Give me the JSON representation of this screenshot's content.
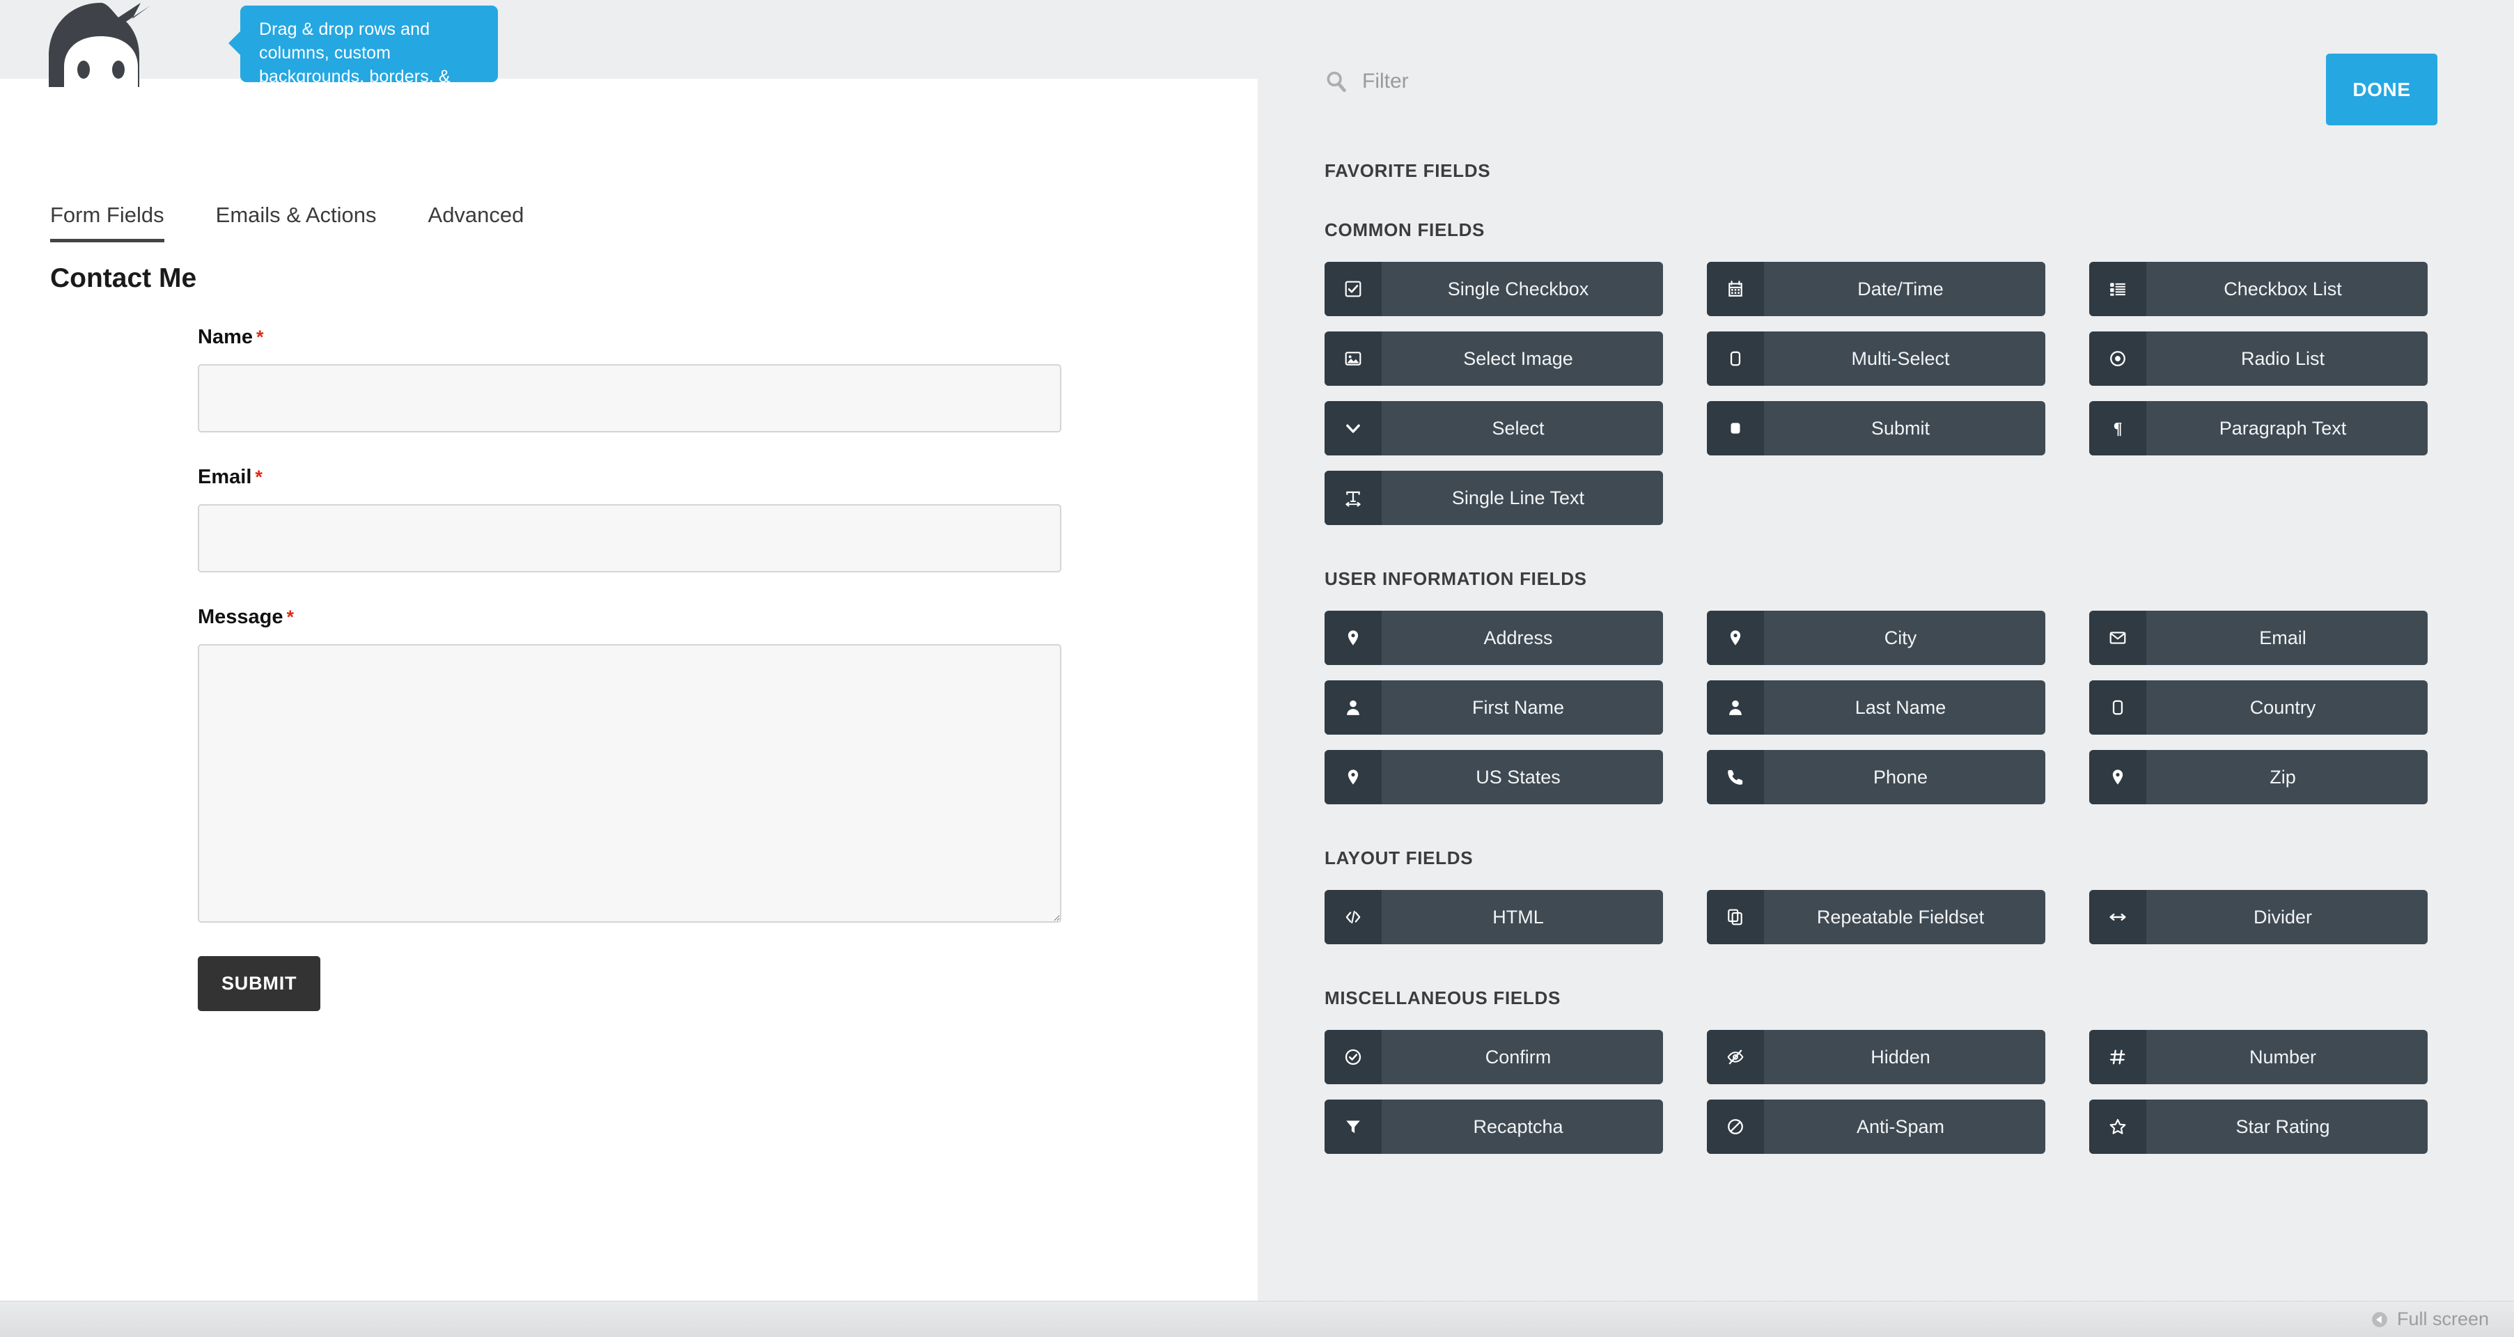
{
  "tooltip": {
    "text": "Drag & drop rows and columns, custom backgrounds, borders, & more without writing a single line of code."
  },
  "logo": {
    "name": "ninja-forms-logo"
  },
  "tabs": [
    {
      "label": "Form Fields",
      "active": true
    },
    {
      "label": "Emails & Actions",
      "active": false
    },
    {
      "label": "Advanced",
      "active": false
    }
  ],
  "form": {
    "title": "Contact Me",
    "required_mark": "*",
    "fields": [
      {
        "label": "Name",
        "required": true,
        "type": "text",
        "value": "",
        "placeholder": ""
      },
      {
        "label": "Email",
        "required": true,
        "type": "text",
        "value": "",
        "placeholder": ""
      },
      {
        "label": "Message",
        "required": true,
        "type": "textarea",
        "value": "",
        "placeholder": ""
      }
    ],
    "submit_label": "SUBMIT"
  },
  "chooser": {
    "search": {
      "placeholder": "Filter",
      "value": "",
      "icon": "search-icon"
    },
    "done_label": "DONE",
    "sections": [
      {
        "title": "FAVORITE FIELDS",
        "items": []
      },
      {
        "title": "COMMON FIELDS",
        "items": [
          {
            "label": "Single Checkbox",
            "icon": "checkbox-checked-icon"
          },
          {
            "label": "Date/Time",
            "icon": "calendar-icon"
          },
          {
            "label": "Checkbox List",
            "icon": "list-icon"
          },
          {
            "label": "Select Image",
            "icon": "image-icon"
          },
          {
            "label": "Multi-Select",
            "icon": "rounded-square-outline-icon"
          },
          {
            "label": "Radio List",
            "icon": "radio-dot-icon"
          },
          {
            "label": "Select",
            "icon": "chevron-down-icon"
          },
          {
            "label": "Submit",
            "icon": "rounded-square-filled-icon"
          },
          {
            "label": "Paragraph Text",
            "icon": "pilcrow-icon"
          },
          {
            "label": "Single Line Text",
            "icon": "text-width-icon"
          }
        ]
      },
      {
        "title": "USER INFORMATION FIELDS",
        "items": [
          {
            "label": "Address",
            "icon": "map-pin-icon"
          },
          {
            "label": "City",
            "icon": "map-pin-icon"
          },
          {
            "label": "Email",
            "icon": "envelope-icon"
          },
          {
            "label": "First Name",
            "icon": "user-icon"
          },
          {
            "label": "Last Name",
            "icon": "user-icon"
          },
          {
            "label": "Country",
            "icon": "rounded-square-outline-icon"
          },
          {
            "label": "US States",
            "icon": "map-pin-icon"
          },
          {
            "label": "Phone",
            "icon": "phone-icon"
          },
          {
            "label": "Zip",
            "icon": "map-pin-icon"
          }
        ]
      },
      {
        "title": "LAYOUT FIELDS",
        "items": [
          {
            "label": "HTML",
            "icon": "code-icon"
          },
          {
            "label": "Repeatable Fieldset",
            "icon": "copy-icon"
          },
          {
            "label": "Divider",
            "icon": "arrows-horizontal-icon"
          }
        ]
      },
      {
        "title": "MISCELLANEOUS FIELDS",
        "items": [
          {
            "label": "Confirm",
            "icon": "check-circle-icon"
          },
          {
            "label": "Hidden",
            "icon": "eye-slash-icon"
          },
          {
            "label": "Number",
            "icon": "hash-icon"
          },
          {
            "label": "Recaptcha",
            "icon": "funnel-icon"
          },
          {
            "label": "Anti-Spam",
            "icon": "ban-icon"
          },
          {
            "label": "Star Rating",
            "icon": "star-icon"
          }
        ]
      }
    ]
  },
  "bottom_bar": {
    "fullscreen_label": "Full screen",
    "fullscreen_icon": "play-left-circle-icon"
  },
  "colors": {
    "accent_blue": "#25a7e2",
    "panel_bg": "#eceeef",
    "button_body": "#3f4a53",
    "button_icon_box": "#303a42",
    "required_red": "#e02b16",
    "submit_dark": "#333333"
  }
}
